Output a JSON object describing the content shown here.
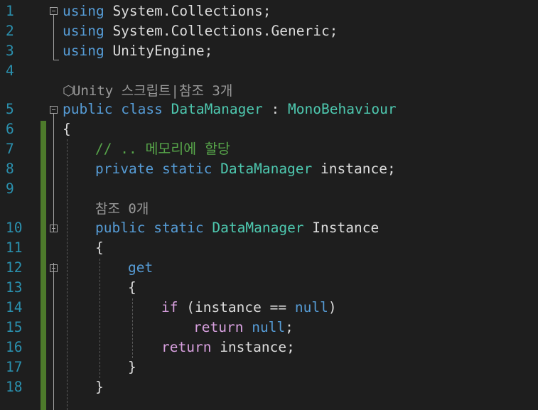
{
  "editor": {
    "line_numbers": [
      "1",
      "2",
      "3",
      "4",
      "5",
      "6",
      "7",
      "8",
      "9",
      "10",
      "11",
      "12",
      "13",
      "14",
      "15",
      "16",
      "17",
      "18"
    ],
    "lines": {
      "l1": {
        "kw": "using",
        "rest": " System.Collections;"
      },
      "l2": {
        "kw": "using",
        "rest": " System.Collections.Generic;"
      },
      "l3": {
        "kw": "using",
        "rest": " UnityEngine;"
      },
      "l5": {
        "kw1": "public",
        "kw2": "class",
        "type": "DataManager",
        "sep": " : ",
        "base": "MonoBehaviour"
      },
      "l6": {
        "text": "{"
      },
      "l7": {
        "comment": "// .. 메모리에 할당"
      },
      "l8": {
        "kw1": "private",
        "kw2": "static",
        "type": "DataManager",
        "rest": " instance;"
      },
      "l10": {
        "kw1": "public",
        "kw2": "static",
        "type": "DataManager",
        "rest": " Instance"
      },
      "l11": {
        "text": "{"
      },
      "l12": {
        "kw": "get"
      },
      "l13": {
        "text": "{"
      },
      "l14": {
        "ctl": "if",
        "open": " (instance == ",
        "kw": "null",
        "close": ")"
      },
      "l15": {
        "ctl": "return",
        "kw": "null",
        "semi": ";"
      },
      "l16": {
        "ctl": "return",
        "rest": " instance;"
      },
      "l17": {
        "text": "}"
      },
      "l18": {
        "text": "}"
      }
    },
    "codelens": {
      "class_lens": {
        "icon": "⬡",
        "text": "Unity 스크립트|참조 3개"
      },
      "prop_lens": {
        "text": "참조 0개"
      }
    },
    "colors": {
      "background": "#1e1e1e",
      "keyword": "#569cd6",
      "control": "#d8a0df",
      "type": "#4ec9b0",
      "comment": "#57a64a",
      "line_number": "#2b91af",
      "change_bar": "#4d7a2b"
    }
  }
}
